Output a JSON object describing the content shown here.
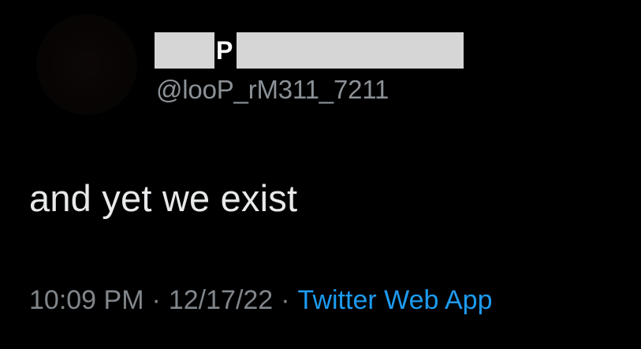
{
  "tweet": {
    "author": {
      "display_name_visible": "P",
      "handle": "@looP_rM311_7211"
    },
    "text": "and yet we exist",
    "time": "10:09 PM",
    "date": "12/17/22",
    "separator": "·",
    "source": "Twitter Web App"
  },
  "colors": {
    "background": "#000000",
    "text": "#e7e9ea",
    "secondary_text": "#80868b",
    "link": "#1d9bf0",
    "redaction": "#d6d6d6"
  }
}
